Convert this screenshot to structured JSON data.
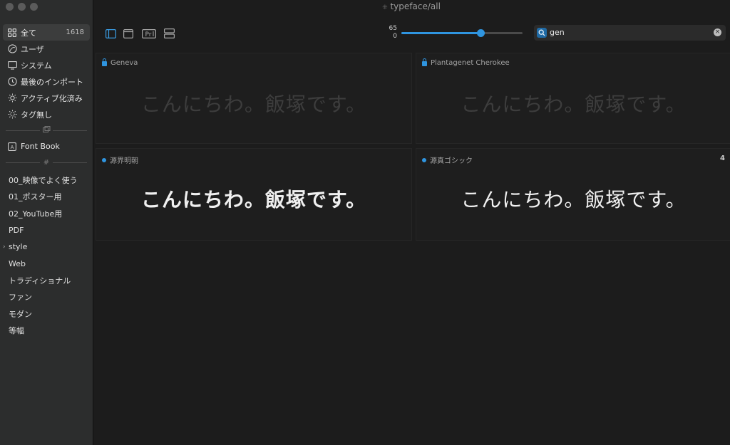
{
  "window": {
    "title": "typeface/all"
  },
  "sidebar": {
    "main_items": [
      {
        "label": "全て",
        "count": "1618",
        "icon": "grid-icon",
        "active": true
      },
      {
        "label": "ユーザ",
        "icon": "user-circle-icon"
      },
      {
        "label": "システム",
        "icon": "monitor-icon"
      },
      {
        "label": "最後のインポート",
        "icon": "clock-icon"
      },
      {
        "label": "アクティブ化済み",
        "icon": "sun-icon"
      },
      {
        "label": "タグ無し",
        "icon": "sun-outline-icon"
      }
    ],
    "library_items": [
      {
        "label": "Font Book",
        "icon": "book-icon"
      }
    ],
    "tags": [
      {
        "label": "00_映像でよく使う"
      },
      {
        "label": "01_ポスター用"
      },
      {
        "label": "02_YouTube用"
      },
      {
        "label": "PDF"
      },
      {
        "label": "style",
        "expandable": true
      },
      {
        "label": "Web"
      },
      {
        "label": "トラディショナル"
      },
      {
        "label": "ファン"
      },
      {
        "label": "モダン"
      },
      {
        "label": "等幅"
      }
    ]
  },
  "toolbar": {
    "size_value": "65",
    "size_min": "0",
    "size_fraction": 0.65,
    "search_value": "gen"
  },
  "fonts": [
    {
      "name": "Geneva",
      "marker": "lock",
      "sample": "こんにちわ。飯塚です。",
      "active": false
    },
    {
      "name": "Plantagenet Cherokee",
      "marker": "lock",
      "sample": "こんにちわ。飯塚です。",
      "active": false
    },
    {
      "name": "源界明朝",
      "marker": "dot",
      "sample": "こんにちわ。飯塚です。",
      "active": true,
      "style": "bold"
    },
    {
      "name": "源真ゴシック",
      "marker": "dot",
      "sample": "こんにちわ。飯塚です。",
      "active": true,
      "style": "light",
      "badge": "4"
    }
  ],
  "colors": {
    "accent": "#2f95e0",
    "sidebar_bg": "#2c2d2d",
    "main_bg": "#1c1c1c"
  }
}
